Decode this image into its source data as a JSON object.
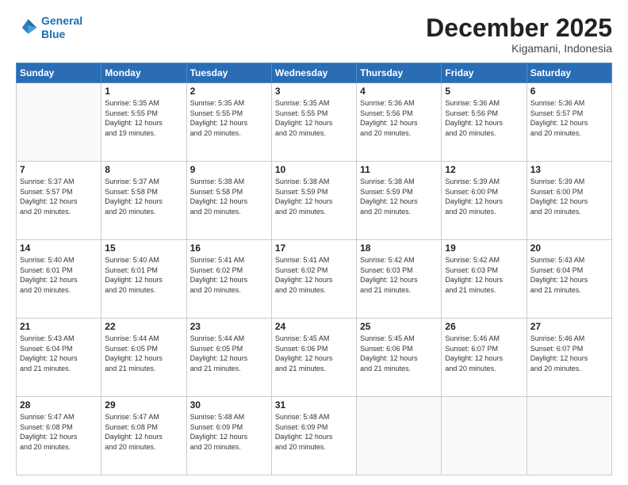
{
  "header": {
    "logo": {
      "line1": "General",
      "line2": "Blue"
    },
    "title": "December 2025",
    "subtitle": "Kigamani, Indonesia"
  },
  "days_of_week": [
    "Sunday",
    "Monday",
    "Tuesday",
    "Wednesday",
    "Thursday",
    "Friday",
    "Saturday"
  ],
  "weeks": [
    [
      {
        "day": "",
        "info": ""
      },
      {
        "day": "1",
        "info": "Sunrise: 5:35 AM\nSunset: 5:55 PM\nDaylight: 12 hours\nand 19 minutes."
      },
      {
        "day": "2",
        "info": "Sunrise: 5:35 AM\nSunset: 5:55 PM\nDaylight: 12 hours\nand 20 minutes."
      },
      {
        "day": "3",
        "info": "Sunrise: 5:35 AM\nSunset: 5:55 PM\nDaylight: 12 hours\nand 20 minutes."
      },
      {
        "day": "4",
        "info": "Sunrise: 5:36 AM\nSunset: 5:56 PM\nDaylight: 12 hours\nand 20 minutes."
      },
      {
        "day": "5",
        "info": "Sunrise: 5:36 AM\nSunset: 5:56 PM\nDaylight: 12 hours\nand 20 minutes."
      },
      {
        "day": "6",
        "info": "Sunrise: 5:36 AM\nSunset: 5:57 PM\nDaylight: 12 hours\nand 20 minutes."
      }
    ],
    [
      {
        "day": "7",
        "info": "Sunrise: 5:37 AM\nSunset: 5:57 PM\nDaylight: 12 hours\nand 20 minutes."
      },
      {
        "day": "8",
        "info": "Sunrise: 5:37 AM\nSunset: 5:58 PM\nDaylight: 12 hours\nand 20 minutes."
      },
      {
        "day": "9",
        "info": "Sunrise: 5:38 AM\nSunset: 5:58 PM\nDaylight: 12 hours\nand 20 minutes."
      },
      {
        "day": "10",
        "info": "Sunrise: 5:38 AM\nSunset: 5:59 PM\nDaylight: 12 hours\nand 20 minutes."
      },
      {
        "day": "11",
        "info": "Sunrise: 5:38 AM\nSunset: 5:59 PM\nDaylight: 12 hours\nand 20 minutes."
      },
      {
        "day": "12",
        "info": "Sunrise: 5:39 AM\nSunset: 6:00 PM\nDaylight: 12 hours\nand 20 minutes."
      },
      {
        "day": "13",
        "info": "Sunrise: 5:39 AM\nSunset: 6:00 PM\nDaylight: 12 hours\nand 20 minutes."
      }
    ],
    [
      {
        "day": "14",
        "info": "Sunrise: 5:40 AM\nSunset: 6:01 PM\nDaylight: 12 hours\nand 20 minutes."
      },
      {
        "day": "15",
        "info": "Sunrise: 5:40 AM\nSunset: 6:01 PM\nDaylight: 12 hours\nand 20 minutes."
      },
      {
        "day": "16",
        "info": "Sunrise: 5:41 AM\nSunset: 6:02 PM\nDaylight: 12 hours\nand 20 minutes."
      },
      {
        "day": "17",
        "info": "Sunrise: 5:41 AM\nSunset: 6:02 PM\nDaylight: 12 hours\nand 20 minutes."
      },
      {
        "day": "18",
        "info": "Sunrise: 5:42 AM\nSunset: 6:03 PM\nDaylight: 12 hours\nand 21 minutes."
      },
      {
        "day": "19",
        "info": "Sunrise: 5:42 AM\nSunset: 6:03 PM\nDaylight: 12 hours\nand 21 minutes."
      },
      {
        "day": "20",
        "info": "Sunrise: 5:43 AM\nSunset: 6:04 PM\nDaylight: 12 hours\nand 21 minutes."
      }
    ],
    [
      {
        "day": "21",
        "info": "Sunrise: 5:43 AM\nSunset: 6:04 PM\nDaylight: 12 hours\nand 21 minutes."
      },
      {
        "day": "22",
        "info": "Sunrise: 5:44 AM\nSunset: 6:05 PM\nDaylight: 12 hours\nand 21 minutes."
      },
      {
        "day": "23",
        "info": "Sunrise: 5:44 AM\nSunset: 6:05 PM\nDaylight: 12 hours\nand 21 minutes."
      },
      {
        "day": "24",
        "info": "Sunrise: 5:45 AM\nSunset: 6:06 PM\nDaylight: 12 hours\nand 21 minutes."
      },
      {
        "day": "25",
        "info": "Sunrise: 5:45 AM\nSunset: 6:06 PM\nDaylight: 12 hours\nand 21 minutes."
      },
      {
        "day": "26",
        "info": "Sunrise: 5:46 AM\nSunset: 6:07 PM\nDaylight: 12 hours\nand 20 minutes."
      },
      {
        "day": "27",
        "info": "Sunrise: 5:46 AM\nSunset: 6:07 PM\nDaylight: 12 hours\nand 20 minutes."
      }
    ],
    [
      {
        "day": "28",
        "info": "Sunrise: 5:47 AM\nSunset: 6:08 PM\nDaylight: 12 hours\nand 20 minutes."
      },
      {
        "day": "29",
        "info": "Sunrise: 5:47 AM\nSunset: 6:08 PM\nDaylight: 12 hours\nand 20 minutes."
      },
      {
        "day": "30",
        "info": "Sunrise: 5:48 AM\nSunset: 6:09 PM\nDaylight: 12 hours\nand 20 minutes."
      },
      {
        "day": "31",
        "info": "Sunrise: 5:48 AM\nSunset: 6:09 PM\nDaylight: 12 hours\nand 20 minutes."
      },
      {
        "day": "",
        "info": ""
      },
      {
        "day": "",
        "info": ""
      },
      {
        "day": "",
        "info": ""
      }
    ]
  ]
}
